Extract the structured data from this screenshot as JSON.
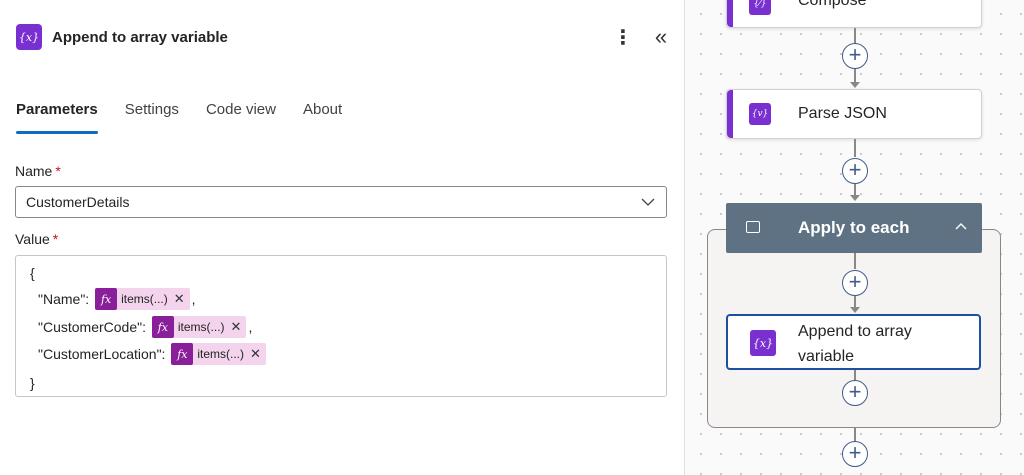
{
  "panel": {
    "icon_text": "{x}",
    "title": "Append to array variable",
    "more_label": "⋮",
    "collapse_label": "«",
    "tabs": [
      {
        "label": "Parameters",
        "active": true
      },
      {
        "label": "Settings",
        "active": false
      },
      {
        "label": "Code view",
        "active": false
      },
      {
        "label": "About",
        "active": false
      }
    ],
    "name_field": {
      "label": "Name",
      "required_mark": "*",
      "value": "CustomerDetails"
    },
    "value_field": {
      "label": "Value",
      "required_mark": "*",
      "open_brace": "{",
      "close_brace": "}",
      "lines": [
        {
          "key": "\"Name\": ",
          "token_icon": "fx",
          "token_text": "items(...)",
          "token_remove": "✕",
          "suffix": ","
        },
        {
          "key": "\"CustomerCode\": ",
          "token_icon": "fx",
          "token_text": "items(...)",
          "token_remove": "✕",
          "suffix": ","
        },
        {
          "key": "\"CustomerLocation\": ",
          "token_icon": "fx",
          "token_text": "items(...)",
          "token_remove": "✕",
          "suffix": ""
        }
      ]
    }
  },
  "canvas": {
    "nodes": [
      {
        "label": "Compose",
        "icon_text": "{⁄}"
      },
      {
        "label": "Parse JSON",
        "icon_text": "{v}"
      }
    ],
    "scope": {
      "title": "Apply to each"
    },
    "selected_node": {
      "label": "Append to array variable",
      "icon_text": "{x}"
    },
    "add_label": "+"
  },
  "colors": {
    "accent": "#0f6cbd",
    "variable_purple": "#7a2fd0",
    "token_bg": "#f3d4ec",
    "fx_bg": "#8a1f9a",
    "scope_header": "#5f7283",
    "selected_border": "#1f4fa0"
  }
}
